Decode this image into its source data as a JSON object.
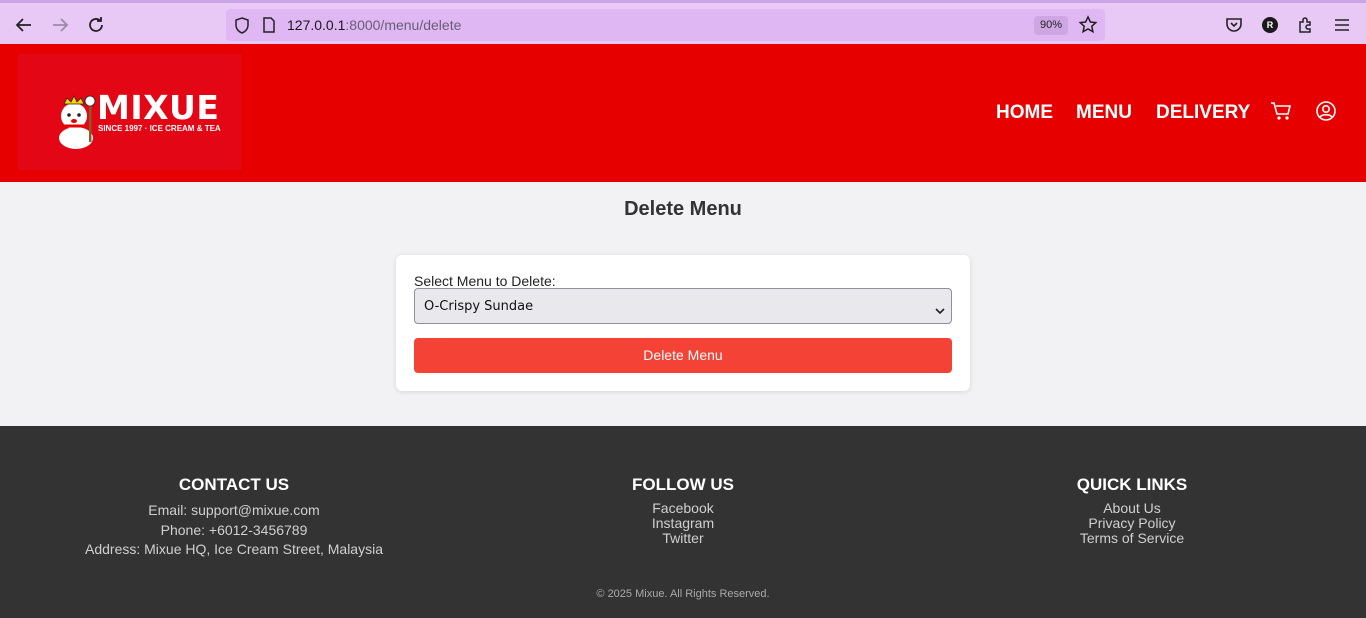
{
  "browser": {
    "url_host": "127.0.0.1",
    "url_path": ":8000/menu/delete",
    "zoom": "90%",
    "profile_initial": "R"
  },
  "brand": {
    "name": "MIXUE",
    "tagline": "SINCE 1997 · ICE CREAM & TEA",
    "accent": "#e60000"
  },
  "nav": {
    "items": [
      {
        "label": "HOME"
      },
      {
        "label": "MENU"
      },
      {
        "label": "DELIVERY"
      }
    ],
    "icons": [
      "cart-icon",
      "user-icon"
    ]
  },
  "page": {
    "title": "Delete Menu"
  },
  "form": {
    "select_label": "Select Menu to Delete:",
    "selected_menu": "O-Crispy Sundae",
    "submit_label": "Delete Menu",
    "submit_color": "#f44336"
  },
  "footer": {
    "contact": {
      "heading": "CONTACT US",
      "lines": [
        "Email: support@mixue.com",
        "Phone: +6012-3456789",
        "Address: Mixue HQ, Ice Cream Street, Malaysia"
      ]
    },
    "follow": {
      "heading": "FOLLOW US",
      "links": [
        "Facebook",
        "Instagram",
        "Twitter"
      ]
    },
    "quick": {
      "heading": "QUICK LINKS",
      "links": [
        "About Us",
        "Privacy Policy",
        "Terms of Service"
      ]
    },
    "copyright": "© 2025 Mixue. All Rights Reserved."
  }
}
